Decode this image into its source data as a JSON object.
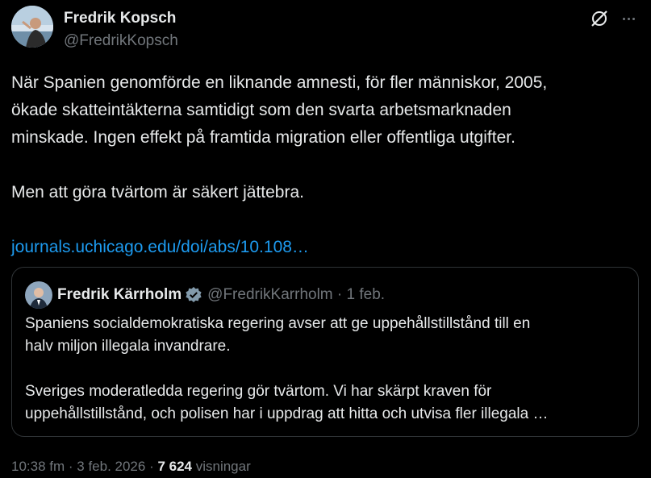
{
  "author": {
    "display_name": "Fredrik Kopsch",
    "handle": "@FredrikKopsch"
  },
  "tweet": {
    "para1_line1": "När Spanien genomförde en liknande amnesti, för fler människor, 2005,",
    "para1_line2": "ökade skatteintäkterna samtidigt som den svarta arbetsmarknaden",
    "para1_line3": "minskade. Ingen effekt på framtida migration eller offentliga utgifter.",
    "para2": "Men att göra tvärtom är säkert jättebra.",
    "link": "journals.uchicago.edu/doi/abs/10.108…"
  },
  "quote": {
    "display_name": "Fredrik Kärrholm",
    "handle_and_date": "@FredrikKarrholm · 1 feb.",
    "para1_line1": "Spaniens socialdemokratiska regering avser att ge uppehållstillstånd till en",
    "para1_line2": "halv miljon illegala invandrare.",
    "para2_line1": "Sveriges moderatledda regering gör tvärtom. Vi har skärpt kraven för",
    "para2_line2": "uppehållstillstånd, och polisen har i uppdrag att hitta och utvisa fler illegala …"
  },
  "meta": {
    "time": "10:38 fm",
    "separator1": " · ",
    "date": "3 feb. 2026",
    "separator2": " · ",
    "views_count": "7 624",
    "views_label": " visningar"
  },
  "colors": {
    "background": "#000000",
    "text": "#e7e9ea",
    "muted": "#71767b",
    "link": "#1d9bf0",
    "border": "#2f3336",
    "verified": "#829aab"
  },
  "icons": {
    "grok": "grok-slash-circle-icon",
    "more": "more-dots-icon",
    "verified": "verified-badge-icon"
  }
}
